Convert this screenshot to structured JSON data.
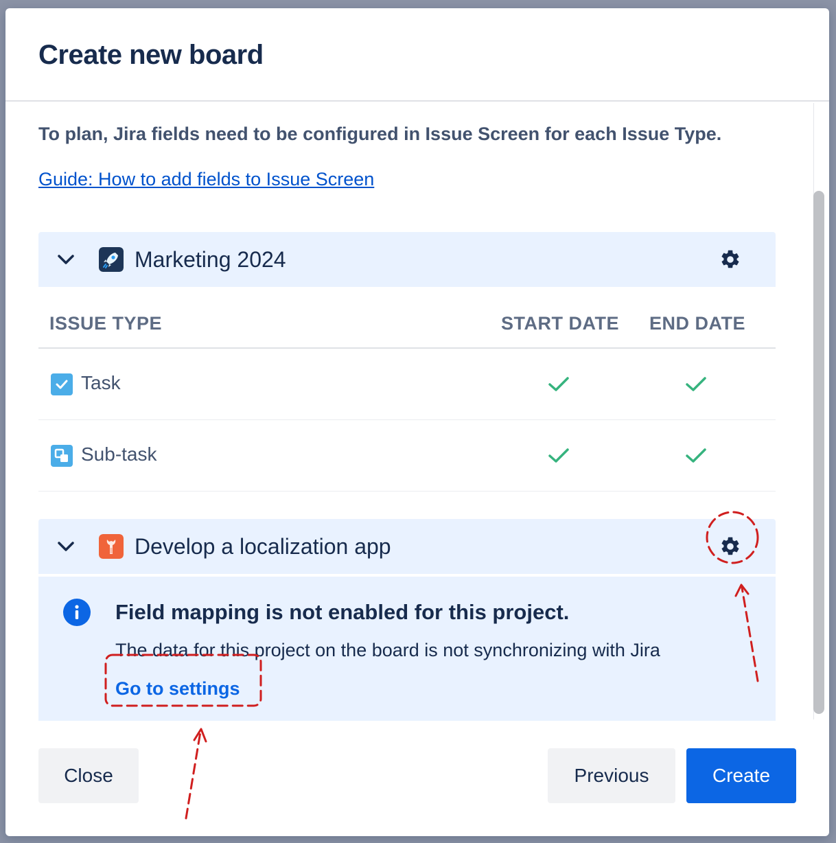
{
  "modal": {
    "title": "Create new board",
    "intro": "To plan, Jira fields need to be configured in Issue Screen for each Issue Type.",
    "guide_link": "Guide: How to add fields to Issue Screen"
  },
  "projects": [
    {
      "name": "Marketing 2024",
      "avatar_icon": "rocket-icon",
      "columns": [
        "ISSUE TYPE",
        "START DATE",
        "END DATE"
      ],
      "rows": [
        {
          "type": "Task",
          "icon": "task-checkbox-icon",
          "start": true,
          "end": true
        },
        {
          "type": "Sub-task",
          "icon": "subtask-icon",
          "start": true,
          "end": true
        }
      ]
    },
    {
      "name": "Develop a localization app",
      "avatar_icon": "wrench-icon",
      "notice": {
        "title": "Field mapping is not enabled for this project.",
        "text": "The data for this project on the board is not synchronizing with Jira",
        "link": "Go to settings"
      }
    }
  ],
  "footer": {
    "close_label": "Close",
    "previous_label": "Previous",
    "create_label": "Create"
  },
  "colors": {
    "primary": "#0c66e4",
    "project_header_bg": "#e9f2ff",
    "check": "#36b37e",
    "annotation": "#d01f1f"
  }
}
